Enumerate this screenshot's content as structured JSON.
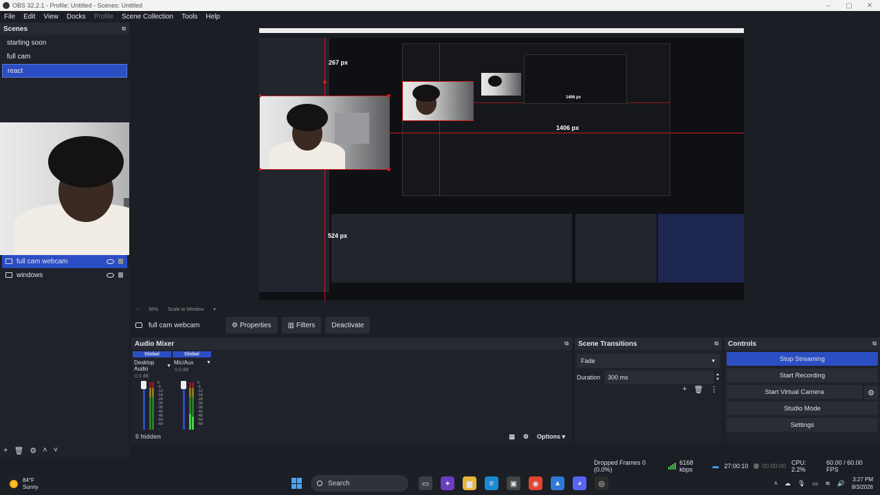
{
  "window": {
    "title": "OBS 32.2.1 - Profile: Untitled - Scenes: Untitled",
    "min": "–",
    "max": "▢",
    "close": "✕"
  },
  "menu": [
    "File",
    "Edit",
    "View",
    "Docks",
    "Profile",
    "Scene Collection",
    "Tools",
    "Help"
  ],
  "scenes": {
    "title": "Scenes",
    "items": [
      "starting soon",
      "full cam",
      "react"
    ],
    "active": "react"
  },
  "sources": {
    "items": [
      {
        "name": "full cam webcam"
      },
      {
        "name": "windows"
      }
    ]
  },
  "preview_labels": {
    "px267": "267 px",
    "px1406_a": "1406 px",
    "px1406_b": "1406 px",
    "px524": "524 px"
  },
  "zoom": {
    "value": "55%",
    "mode": "Scale to Window"
  },
  "context": {
    "source": "full cam webcam",
    "properties": "Properties",
    "filters": "Filters",
    "deactivate": "Deactivate"
  },
  "mixer": {
    "title": "Audio Mixer",
    "channels": [
      {
        "tag": "Global",
        "name": "Desktop Audio",
        "db": "0.0 dB"
      },
      {
        "tag": "Global",
        "name": "Mic/Aux",
        "db": "0.0 dB"
      }
    ],
    "scale": [
      "0",
      "-6",
      "-12",
      "-18",
      "-24",
      "-30",
      "-36",
      "-42",
      "-48",
      "-54",
      "-60"
    ],
    "hidden": "0 hidden",
    "options": "Options"
  },
  "transitions": {
    "title": "Scene Transitions",
    "selected": "Fade",
    "duration_label": "Duration",
    "duration": "300 ms"
  },
  "controls": {
    "title": "Controls",
    "stream": "Stop Streaming",
    "record": "Start Recording",
    "vcam": "Start Virtual Camera",
    "studio": "Studio Mode",
    "settings": "Settings"
  },
  "status": {
    "dropped": "Dropped Frames 0 (0.0%)",
    "kbps": "6168 kbps",
    "stream_time": "27:00:10",
    "rec_time": "00:00:00",
    "cpu": "CPU: 2.2%",
    "fps": "60.00 / 60.00 FPS"
  },
  "taskbar": {
    "temp": "84°F",
    "weather": "Sunny",
    "search": "Search",
    "time": "3:27 PM",
    "date": "8/3/2026"
  },
  "colors": {
    "accent": "#2c4ec4",
    "red_guide": "#d21a1a",
    "meter_green": "#49d349"
  }
}
